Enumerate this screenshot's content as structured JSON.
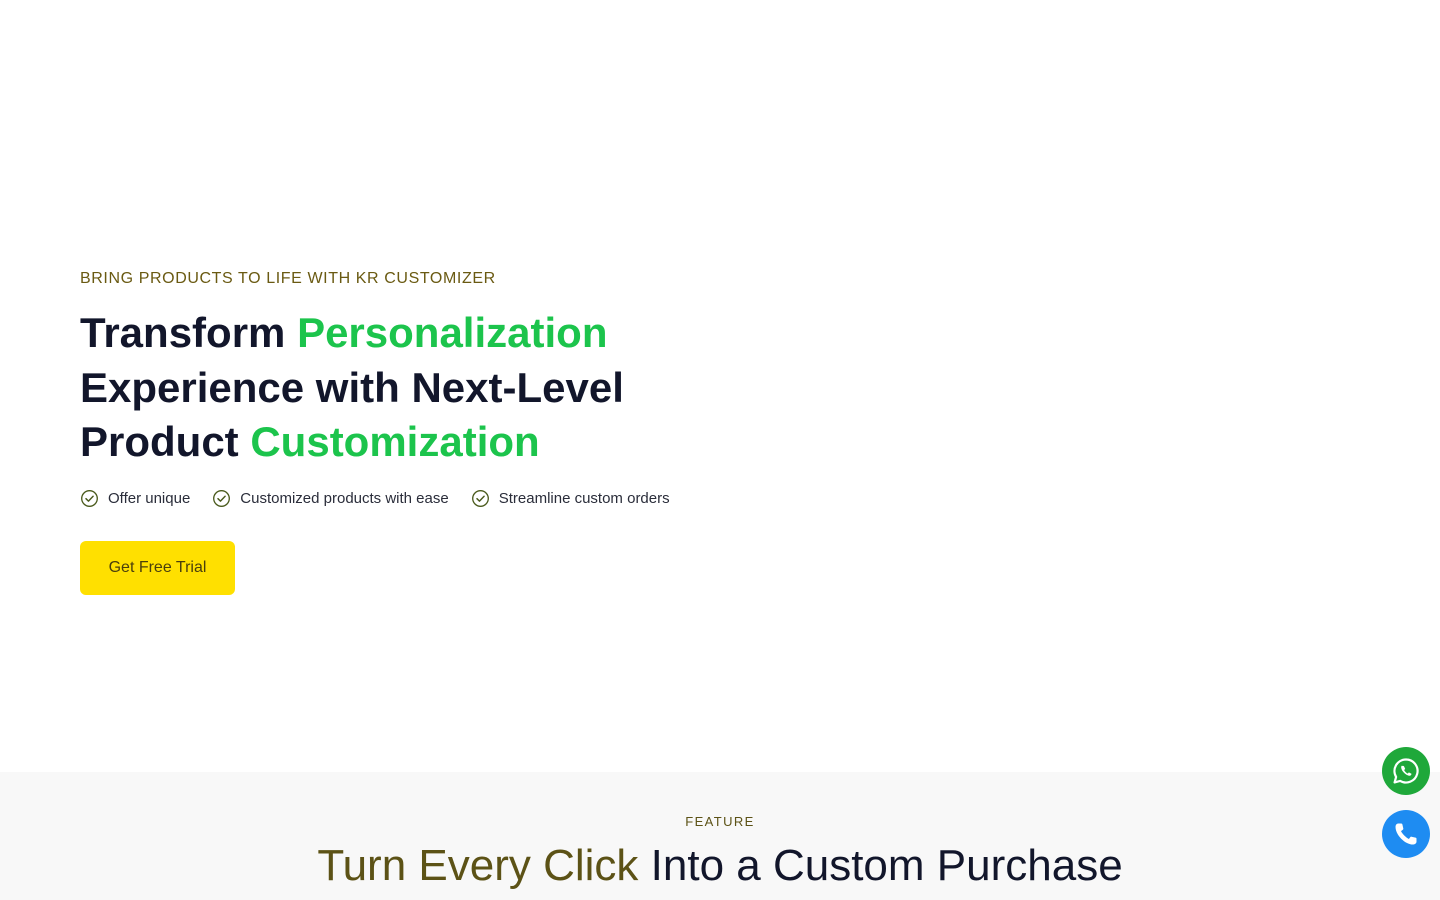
{
  "hero": {
    "eyebrow": "BRING PRODUCTS TO LIFE WITH KR CUSTOMIZER",
    "headline": {
      "line1_plain": "Transform ",
      "line1_highlight": "Personalization",
      "line2": "Experience with Next-Level",
      "line3_plain": "Product ",
      "line3_highlight": "Customization"
    },
    "bullets": [
      {
        "label": "Offer unique",
        "icon": "check-circle-icon"
      },
      {
        "label": "Customized products with ease",
        "icon": "check-circle-icon"
      },
      {
        "label": "Streamline custom orders",
        "icon": "check-circle-icon"
      }
    ],
    "cta_label": "Get Free Trial"
  },
  "feature": {
    "eyebrow": "FEATURE",
    "title_accent": "Turn Every Click",
    "title_rest": " Into a Custom Purchase"
  },
  "floating": {
    "whatsapp_icon": "whatsapp-icon",
    "phone_icon": "phone-icon"
  },
  "colors": {
    "headline": "#12162b",
    "highlight_green": "#1cc44c",
    "eyebrow_olive": "#6a5a12",
    "cta_yellow": "#ffe000",
    "whatsapp_green": "#1fa83a",
    "phone_blue": "#1e8cf2"
  }
}
